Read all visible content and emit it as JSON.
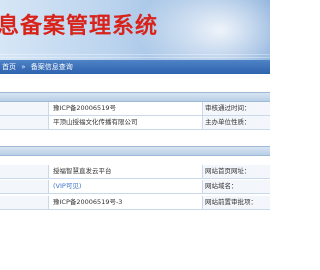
{
  "header": {
    "title": "息备案管理系统"
  },
  "nav": {
    "home": "首页",
    "separator": "»",
    "current": "备案信息查询"
  },
  "unit_info": {
    "license_no": "豫ICP备20006519号",
    "unit_name": "平顶山授福文化传播有限公司",
    "approve_time_label": "审核通过时间：",
    "unit_nature_label": "主办单位性质："
  },
  "site_info": {
    "site_name": "授福智慧直发云平台",
    "site_home": "(VIP可见)",
    "site_license_no": "豫ICP备20006519号-3",
    "site_home_label": "网站首页网址：",
    "domain_label": "网站域名：",
    "pre_approval_label": "网站前置审批项："
  },
  "colors": {
    "title_red": "#d9231a",
    "nav_blue": "#2d62ad",
    "link_blue": "#3b6fc6"
  }
}
